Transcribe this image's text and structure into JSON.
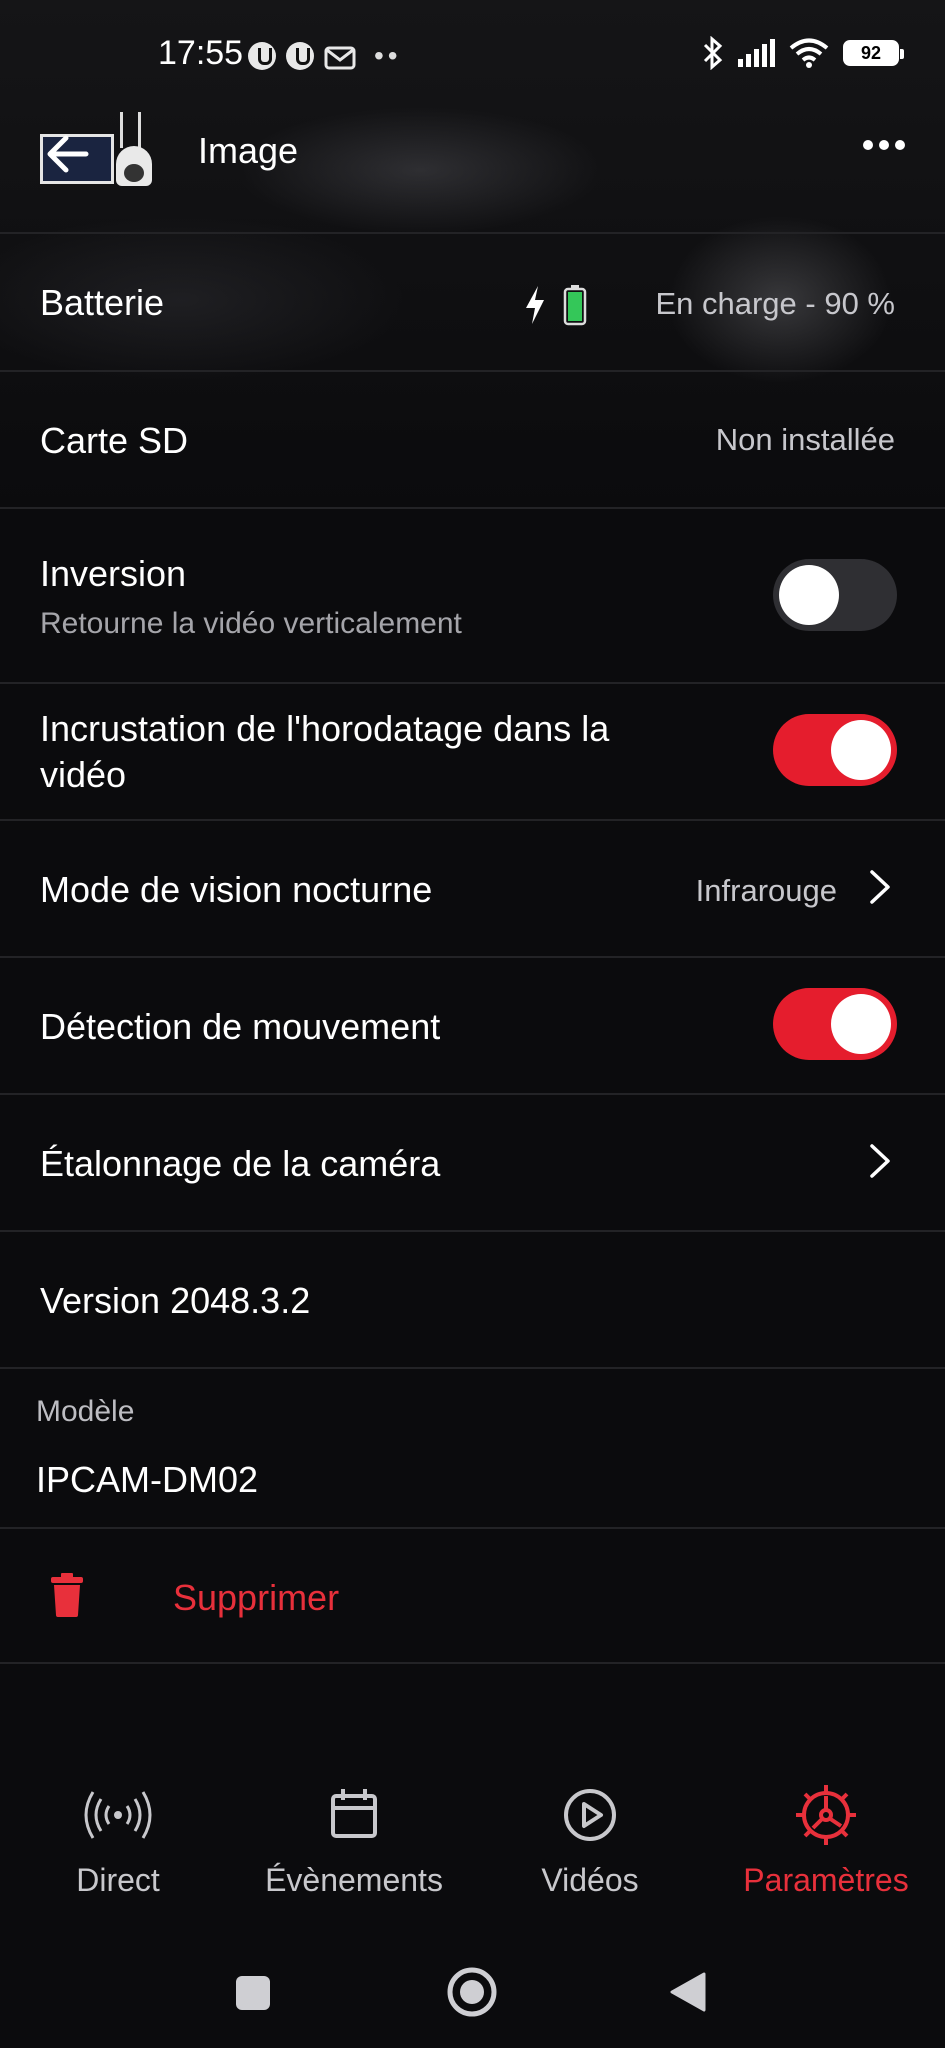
{
  "status": {
    "time": "17:55",
    "battery": "92"
  },
  "header": {
    "title": "Image"
  },
  "rows": {
    "battery_label": "Batterie",
    "battery_value": "En charge - 90 %",
    "sd_label": "Carte SD",
    "sd_value": "Non installée",
    "inversion_label": "Inversion",
    "inversion_sub": "Retourne la vidéo verticalement",
    "inversion_on": false,
    "timestamp_label_line1": "Incrustation de l'horodatage dans la",
    "timestamp_label_line2": "vidéo",
    "timestamp_on": true,
    "night_label": "Mode de vision nocturne",
    "night_value": "Infrarouge",
    "motion_label": "Détection de mouvement",
    "motion_on": true,
    "calibration_label": "Étalonnage de la caméra",
    "version_label": "Version 2048.3.2",
    "model_label": "Modèle",
    "model_value": "IPCAM-DM02",
    "delete_label": "Supprimer"
  },
  "nav": {
    "items": [
      {
        "label": "Direct",
        "icon": "broadcast-icon"
      },
      {
        "label": "Évènements",
        "icon": "calendar-icon"
      },
      {
        "label": "Vidéos",
        "icon": "play-circle-icon"
      },
      {
        "label": "Paramètres",
        "icon": "settings-gear-icon",
        "active": true
      }
    ]
  },
  "colors": {
    "accent": "#e51d2d",
    "background": "#0b0b0d",
    "divider": "#232326"
  }
}
